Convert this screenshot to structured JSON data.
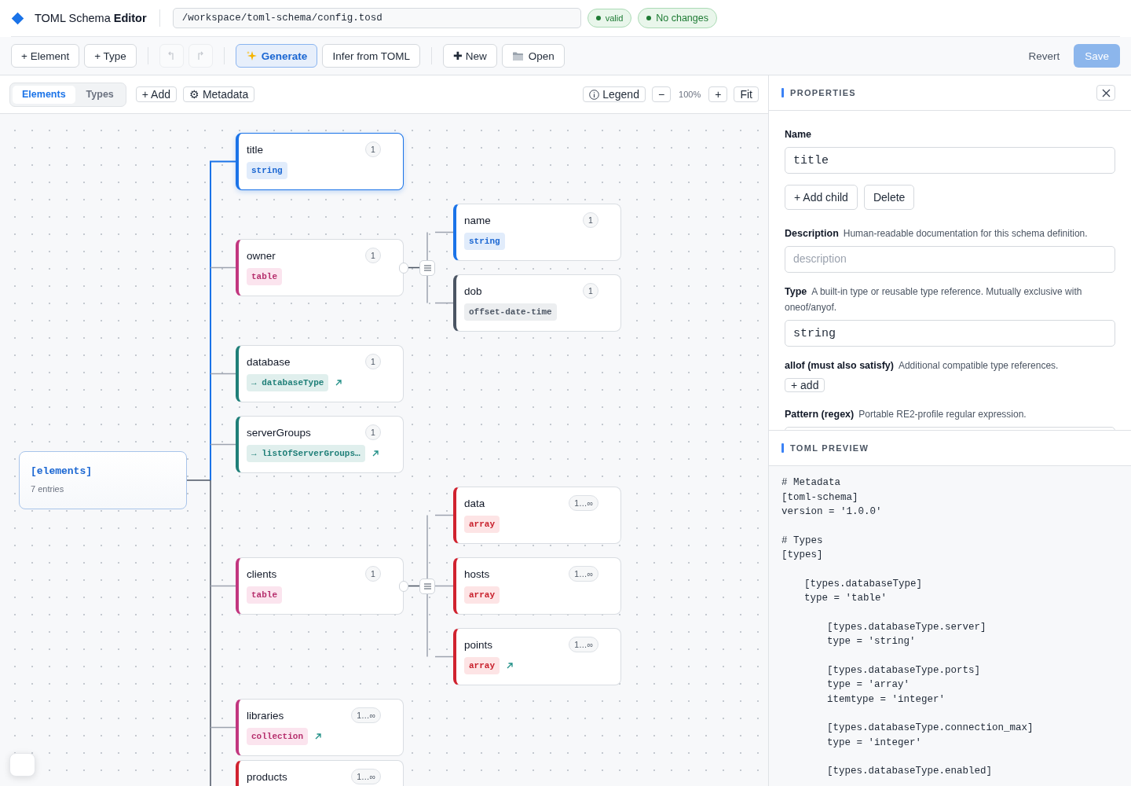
{
  "header": {
    "app_title": "TOML Schema **Editor**",
    "file_path": "/workspace/toml-schema/config.tosd",
    "badges": [
      {
        "label": "valid",
        "kind": "success"
      },
      {
        "label": "No changes",
        "kind": "success"
      }
    ]
  },
  "toolbar": {
    "add_buttons": [
      "+ Element",
      "+ Type"
    ],
    "undo": {
      "disabled": true
    },
    "redo": {
      "disabled": true
    },
    "generate": {
      "label": "Generate",
      "active": true
    },
    "infer": "Infer from TOML",
    "new": "✚ New",
    "open": "Open",
    "revert": "Revert",
    "save": {
      "label": "Save",
      "disabled": true
    }
  },
  "canvas_toolbar": {
    "tabs": [
      {
        "label": "Elements",
        "selected": true
      },
      {
        "label": "Types",
        "selected": false
      }
    ],
    "add": "+ Add",
    "metadata": "⚙ Metadata",
    "legend": "Legend",
    "zoom_out": "−",
    "zoom": "100%",
    "zoom_in": "+",
    "fit": "Fit"
  },
  "tree": {
    "root": {
      "label": "[elements]",
      "count": "7 entries"
    },
    "nodes": [
      {
        "name": "title",
        "type": "string",
        "kind": "string",
        "cardinality": "1",
        "link": false,
        "selected": true
      },
      {
        "name": "owner",
        "type": "table",
        "kind": "table",
        "cardinality": "1",
        "link": false,
        "selected": false,
        "children": [
          {
            "name": "name",
            "type": "string",
            "kind": "string",
            "cardinality": "1",
            "link": false,
            "selected": false
          },
          {
            "name": "dob",
            "type": "offset-date-time",
            "kind": "datetime",
            "cardinality": "1",
            "link": false,
            "selected": false
          }
        ]
      },
      {
        "name": "database",
        "type": "→ databaseType",
        "kind": "ref",
        "cardinality": "1",
        "link": true,
        "selected": false
      },
      {
        "name": "serverGroups",
        "type": "→ listOfServerGroups…",
        "kind": "ref",
        "cardinality": "1",
        "link": true,
        "selected": false
      },
      {
        "name": "clients",
        "type": "table",
        "kind": "table",
        "cardinality": "1",
        "link": false,
        "selected": false,
        "children": [
          {
            "name": "data",
            "type": "array",
            "kind": "array",
            "cardinality": "1…∞",
            "link": false,
            "selected": false
          },
          {
            "name": "hosts",
            "type": "array",
            "kind": "array",
            "cardinality": "1…∞",
            "link": false,
            "selected": false
          },
          {
            "name": "points",
            "type": "array",
            "kind": "array",
            "cardinality": "1…∞",
            "link": true,
            "selected": false
          }
        ]
      },
      {
        "name": "libraries",
        "type": "collection",
        "kind": "collection",
        "cardinality": "1…∞",
        "link": true,
        "selected": false
      },
      {
        "name": "products",
        "kind": "array",
        "cardinality": "1…∞",
        "link": false,
        "selected": false
      }
    ]
  },
  "properties": {
    "title": "PROPERTIES",
    "name_label": "Name",
    "name_value": "title",
    "actions": [
      "+ Add child",
      "Delete"
    ],
    "description": {
      "label": "Description",
      "hint": "Human-readable documentation for this schema definition.",
      "placeholder": "description"
    },
    "type": {
      "label": "Type",
      "hint": "A built-in type or reusable type reference. Mutually exclusive with oneof/anyof.",
      "value": "string"
    },
    "allof": {
      "label": "allof (must also satisfy)",
      "hint": "Additional compatible type references.",
      "add": "+ add"
    },
    "pattern": {
      "label": "Pattern (regex)",
      "hint": "Portable RE2-profile regular expression."
    }
  },
  "preview": {
    "title": "TOML PREVIEW",
    "blocks": [
      {
        "lines": [
          "# Metadata",
          "[toml-schema]",
          "version = '1.0.0'"
        ]
      },
      {
        "lines": [
          "# Types",
          "[types]"
        ],
        "children": [
          {
            "lines": [
              "[types.databaseType]",
              "type = 'table'"
            ],
            "children": [
              {
                "lines": [
                  "[types.databaseType.server]",
                  "type = 'string'"
                ]
              },
              {
                "lines": [
                  "[types.databaseType.ports]",
                  "type = 'array'",
                  "itemtype = 'integer'"
                ]
              },
              {
                "lines": [
                  "[types.databaseType.connection_max]",
                  "type = 'integer'"
                ]
              },
              {
                "lines": [
                  "[types.databaseType.enabled]"
                ]
              }
            ]
          }
        ]
      }
    ]
  }
}
